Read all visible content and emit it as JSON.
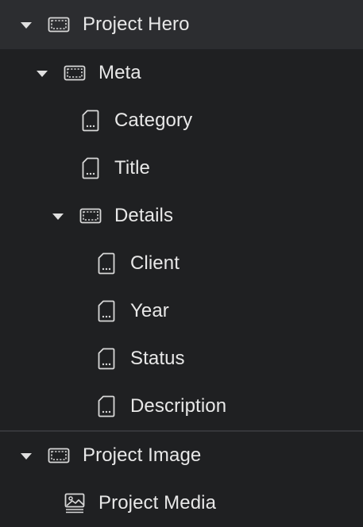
{
  "tree": {
    "items": [
      {
        "label": "Project Hero",
        "type": "section",
        "expanded": true,
        "icon": "section-icon"
      },
      {
        "label": "Meta",
        "type": "section",
        "expanded": true,
        "icon": "section-icon"
      },
      {
        "label": "Category",
        "type": "field",
        "icon": "text-field-icon"
      },
      {
        "label": "Title",
        "type": "field",
        "icon": "text-field-icon"
      },
      {
        "label": "Details",
        "type": "section",
        "expanded": true,
        "icon": "section-icon"
      },
      {
        "label": "Client",
        "type": "field",
        "icon": "text-field-icon"
      },
      {
        "label": "Year",
        "type": "field",
        "icon": "text-field-icon"
      },
      {
        "label": "Status",
        "type": "field",
        "icon": "text-field-icon"
      },
      {
        "label": "Description",
        "type": "field",
        "icon": "text-field-icon"
      },
      {
        "label": "Project Image",
        "type": "section",
        "expanded": true,
        "icon": "section-icon"
      },
      {
        "label": "Project Media",
        "type": "media",
        "icon": "image-icon"
      }
    ]
  },
  "colors": {
    "background": "#1f2022",
    "selected_row": "#2c2d30",
    "text": "#e8e8e8",
    "icon": "#d8d8d8",
    "divider": "#35363a"
  }
}
